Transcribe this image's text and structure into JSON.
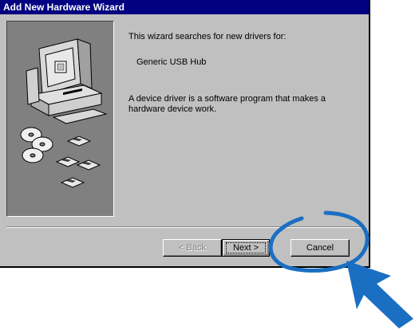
{
  "window": {
    "title": "Add New Hardware Wizard"
  },
  "content": {
    "intro": "This wizard searches for new drivers for:",
    "device": "Generic USB Hub",
    "description_line1": "A device driver is a software program that makes a",
    "description_line2": "hardware device work."
  },
  "buttons": {
    "back": "< Back",
    "next": "Next >",
    "cancel": "Cancel"
  },
  "colors": {
    "titlebar": "#000080",
    "dialog": "#c0c0c0",
    "annotation": "#1a6fc2"
  },
  "icons": {
    "illustration": "computer-with-discs-illustration",
    "annotation_arrow": "arrow-pointer-icon",
    "annotation_ellipse": "highlight-ellipse"
  }
}
